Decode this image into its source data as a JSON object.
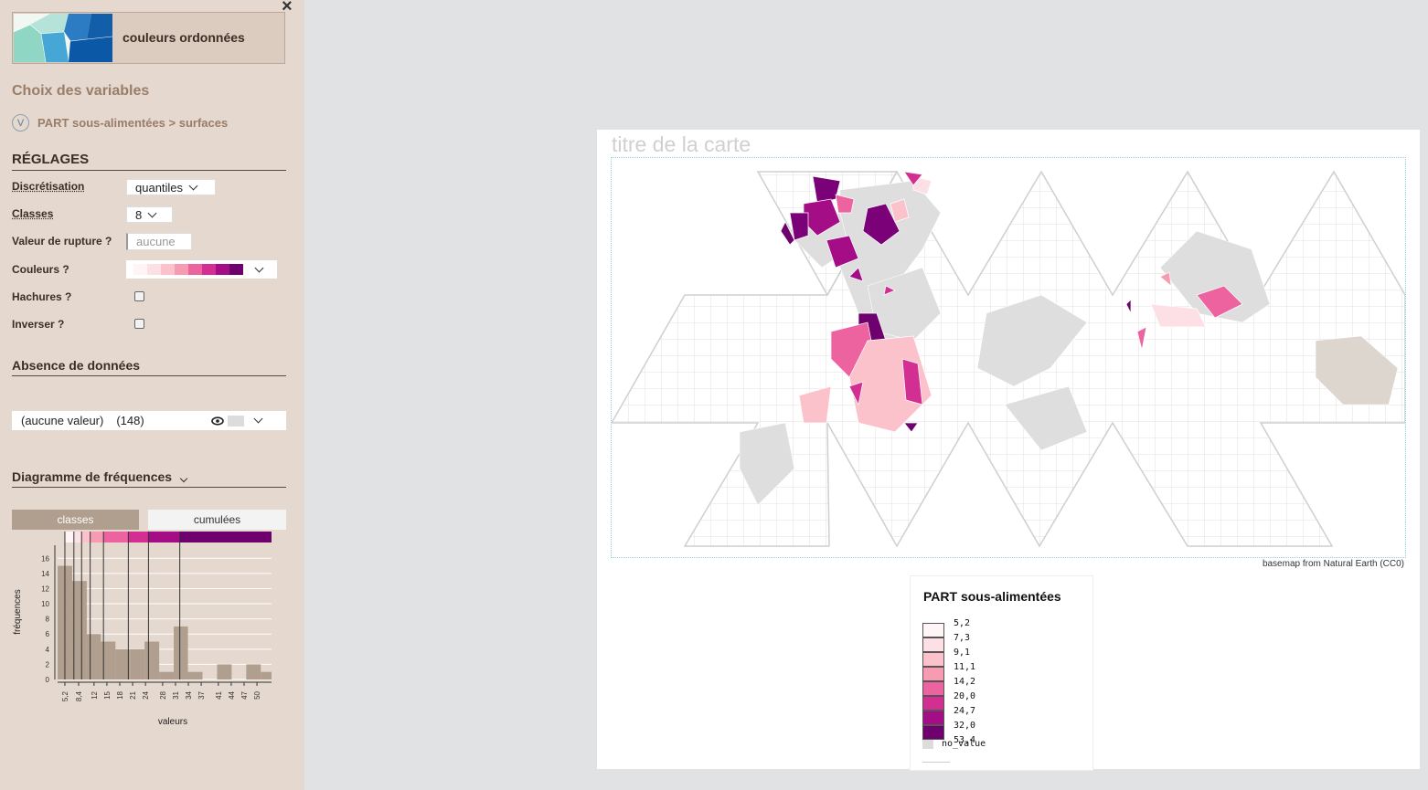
{
  "sidebar": {
    "mode_label": "couleurs ordonnées",
    "vars_heading": "Choix des variables",
    "var_badge": "V",
    "variable": "PART sous-alimentées > surfaces",
    "settings": {
      "heading": "RÉGLAGES",
      "discretisation_label": "Discrétisation",
      "discretisation_value": "quantiles",
      "classes_label": "Classes",
      "classes_value": "8",
      "rupture_label": "Valeur de rupture ?",
      "rupture_placeholder": "aucune",
      "colors_label": "Couleurs ?",
      "palette": [
        "#fff4f6",
        "#fde0e5",
        "#fbc2cc",
        "#f79bb3",
        "#ec63a0",
        "#d32f93",
        "#a50d86",
        "#6e016d"
      ],
      "hatch_label": "Hachures ?",
      "invert_label": "Inverser ?"
    },
    "nodata": {
      "heading": "Absence de données",
      "label": "(aucune valeur)",
      "count": "(148)",
      "color": "#dcdcdc"
    },
    "freq": {
      "heading": "Diagramme de fréquences",
      "tab_classes": "classes",
      "tab_cumulees": "cumulées"
    }
  },
  "chart_data": {
    "type": "bar",
    "xlabel": "valeurs",
    "ylabel": "fréquences",
    "ylim": [
      0,
      17
    ],
    "yticks": [
      0,
      2,
      4,
      6,
      8,
      10,
      12,
      14,
      16
    ],
    "xticks": [
      "5,2",
      "8,4",
      "12",
      "15",
      "18",
      "21",
      "24",
      "28",
      "31",
      "34",
      "37",
      "41",
      "44",
      "47",
      "50"
    ],
    "xlim": [
      3.5,
      53.4
    ],
    "bins": [
      {
        "x0": 3.5,
        "x1": 6.9,
        "count": 15
      },
      {
        "x0": 6.9,
        "x1": 10.3,
        "count": 13
      },
      {
        "x0": 10.3,
        "x1": 13.6,
        "count": 6
      },
      {
        "x0": 13.6,
        "x1": 17.0,
        "count": 5
      },
      {
        "x0": 17.0,
        "x1": 20.4,
        "count": 4
      },
      {
        "x0": 20.4,
        "x1": 23.8,
        "count": 4
      },
      {
        "x0": 23.8,
        "x1": 27.2,
        "count": 5
      },
      {
        "x0": 27.2,
        "x1": 30.6,
        "count": 1
      },
      {
        "x0": 30.6,
        "x1": 33.9,
        "count": 7
      },
      {
        "x0": 33.9,
        "x1": 37.3,
        "count": 1
      },
      {
        "x0": 37.3,
        "x1": 40.7,
        "count": 0
      },
      {
        "x0": 40.7,
        "x1": 44.1,
        "count": 2
      },
      {
        "x0": 44.1,
        "x1": 47.5,
        "count": 0
      },
      {
        "x0": 47.5,
        "x1": 50.9,
        "count": 2
      },
      {
        "x0": 50.9,
        "x1": 53.4,
        "count": 1
      }
    ],
    "breaks": [
      5.2,
      7.3,
      9.1,
      11.1,
      14.2,
      20.0,
      24.7,
      32.0,
      53.4
    ],
    "bar_color": "#b09e8e"
  },
  "map": {
    "title": "titre de la carte",
    "credit": "basemap from Natural Earth (CC0)",
    "land_color": "#dedede",
    "antarctica_color": "#dcd6cf"
  },
  "legend": {
    "title": "PART sous-alimentées",
    "values": [
      "5,2",
      "7,3",
      "9,1",
      "11,1",
      "14,2",
      "20,0",
      "24,7",
      "32,0",
      "53,4"
    ],
    "colors": [
      "#fff4f6",
      "#fde0e5",
      "#fbc2cc",
      "#f79bb3",
      "#ec63a0",
      "#d32f93",
      "#a50d86",
      "#6e016d"
    ],
    "no_value_label": "no_value",
    "no_value_color": "#dcdcdc"
  }
}
